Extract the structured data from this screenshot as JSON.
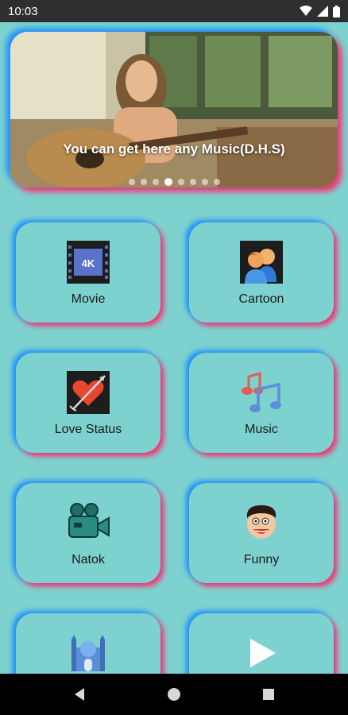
{
  "status": {
    "time": "10:03"
  },
  "banner": {
    "caption": "You can get here any Music(D.H.S)",
    "dot_count": 8,
    "active_dot": 3
  },
  "categories": [
    {
      "label": "Movie",
      "icon": "4k-film-icon"
    },
    {
      "label": "Cartoon",
      "icon": "people-icon"
    },
    {
      "label": "Love Status",
      "icon": "heart-arrow-icon"
    },
    {
      "label": "Music",
      "icon": "music-notes-icon"
    },
    {
      "label": "Natok",
      "icon": "video-camera-icon"
    },
    {
      "label": "Funny",
      "icon": "cartoon-face-icon"
    },
    {
      "label": "",
      "icon": "mosque-icon"
    },
    {
      "label": "",
      "icon": "play-icon"
    }
  ],
  "colors": {
    "background": "#7dd2cf",
    "shadow_blue": "#1a8cff",
    "shadow_pink": "#ff2a6d",
    "status_bar": "#2f2f2f",
    "nav_bar": "#000000"
  }
}
